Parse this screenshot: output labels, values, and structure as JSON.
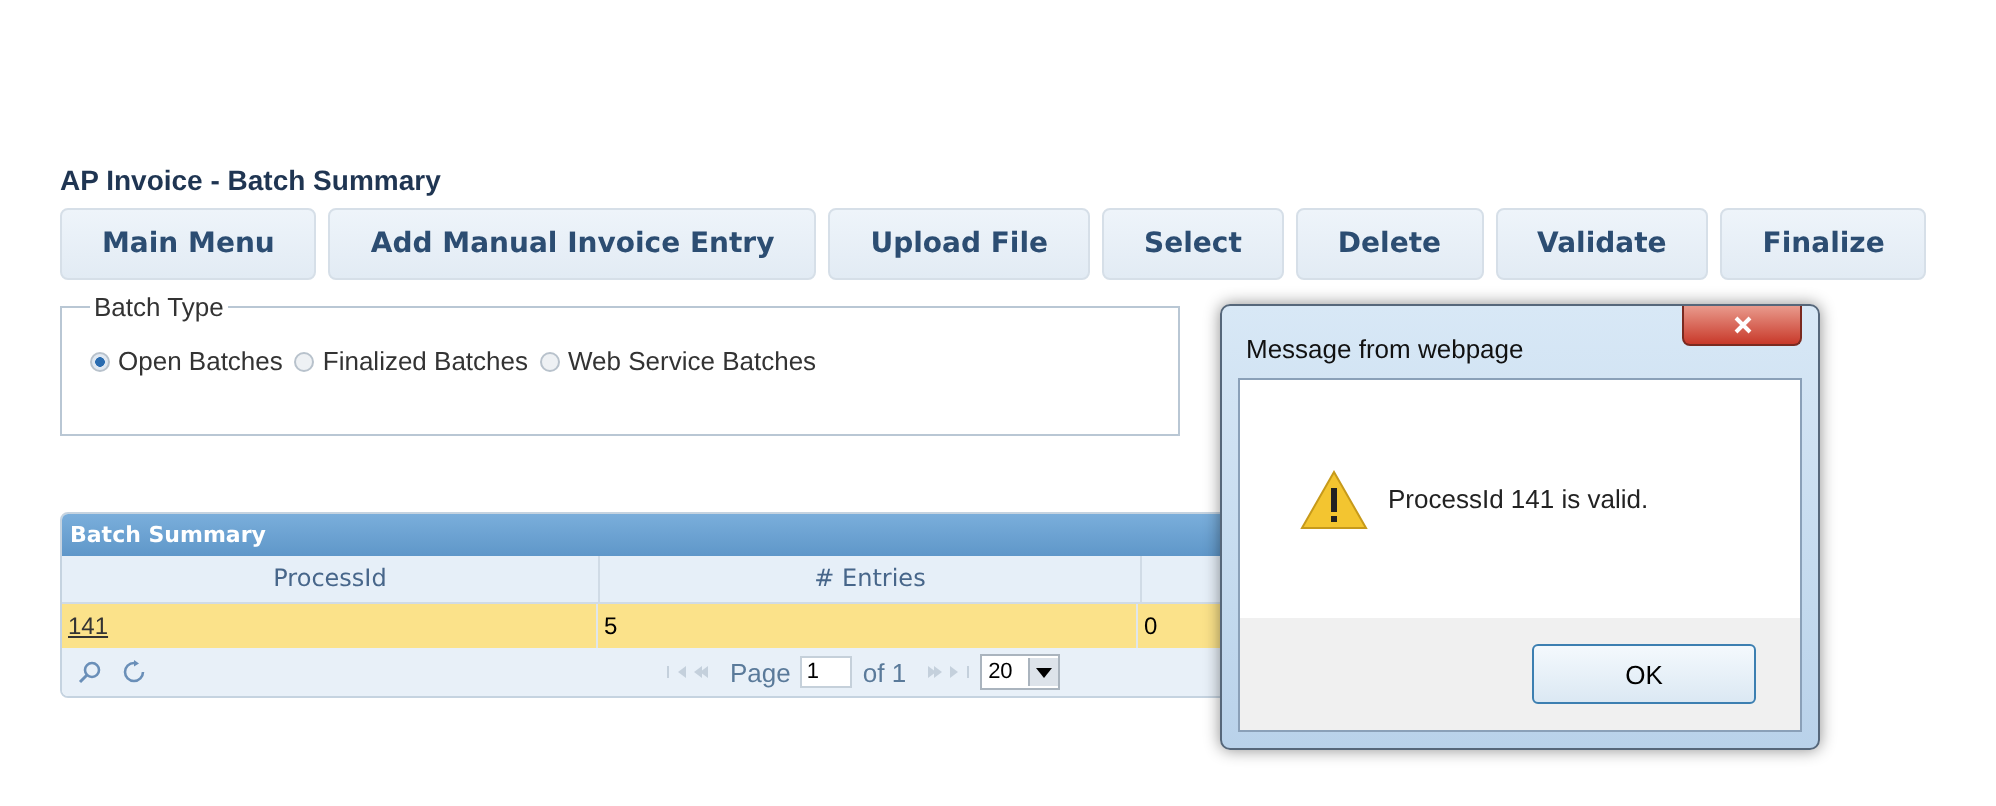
{
  "page": {
    "title": "AP Invoice - Batch Summary"
  },
  "toolbar": [
    "Main Menu",
    "Add Manual Invoice Entry",
    "Upload File",
    "Select",
    "Delete",
    "Validate",
    "Finalize"
  ],
  "batch_type": {
    "legend": "Batch Type",
    "options": [
      {
        "label": "Open Batches",
        "selected": true
      },
      {
        "label": "Finalized Batches",
        "selected": false
      },
      {
        "label": "Web Service Batches",
        "selected": false
      }
    ]
  },
  "grid": {
    "caption": "Batch Summary",
    "columns": [
      "ProcessId",
      "# Entries"
    ],
    "rows": [
      {
        "cells": [
          "141",
          "5",
          "0"
        ],
        "selected": true
      }
    ],
    "pager": {
      "page_label": "Page",
      "page": "1",
      "of_label": "of 1",
      "page_size": "20"
    }
  },
  "dialog": {
    "title": "Message from webpage",
    "message": "ProcessId 141 is valid.",
    "button": "OK"
  }
}
